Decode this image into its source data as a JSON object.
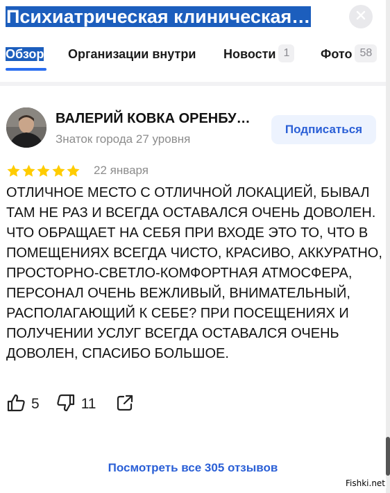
{
  "header": {
    "title": "Психиатрическая клиническая…"
  },
  "tabs": [
    {
      "label": "Обзор",
      "active": true
    },
    {
      "label": "Организации внутри"
    },
    {
      "label": "Новости",
      "count": "1"
    },
    {
      "label": "Фото",
      "count": "58"
    }
  ],
  "review": {
    "author_name": "ВАЛЕРИЙ КОВКА ОРЕНБУ…",
    "author_level": "Знаток города 27 уровня",
    "subscribe_label": "Подписаться",
    "rating": 5,
    "date": "22 января",
    "text": "ОТЛИЧНОЕ МЕСТО С ОТЛИЧНОЙ ЛОКАЦИЕЙ, БЫВАЛ ТАМ НЕ РАЗ И ВСЕГДА ОСТАВАЛСЯ ОЧЕНЬ ДОВОЛЕН. ЧТО ОБРАЩАЕТ НА СЕБЯ ПРИ ВХОДЕ ЭТО ТО, ЧТО В ПОМЕЩЕНИЯХ ВСЕГДА ЧИСТО, КРАСИВО, АККУРАТНО, ПРОСТОРНО-СВЕТЛО-КОМФОРТНАЯ АТМОСФЕРА, ПЕРСОНАЛ ОЧЕНЬ ВЕЖЛИВЫЙ, ВНИМАТЕЛЬНЫЙ, РАСПОЛАГАЮЩИЙ К СЕБЕ? ПРИ ПОСЕЩЕНИЯХ И ПОЛУЧЕНИИ УСЛУГ ВСЕГДА ОСТАВАЛСЯ ОЧЕНЬ ДОВОЛЕН, СПАСИБО БОЛЬШОЕ.",
    "likes": "5",
    "dislikes": "11"
  },
  "footer": {
    "all_reviews_label": "Посмотреть все 305 отзывов"
  },
  "watermark": "Fishki.net",
  "icons": {
    "close": "close-icon",
    "like": "thumbs-up-icon",
    "dislike": "thumbs-down-icon",
    "share": "share-icon",
    "star": "star-icon"
  },
  "colors": {
    "accent": "#2a5fd6",
    "tab_underline": "#2a6ef0",
    "selection": "#1c5ebd",
    "star": "#fc0",
    "muted_text": "#8c8c8c",
    "subscribe_bg": "#edf3fe"
  }
}
